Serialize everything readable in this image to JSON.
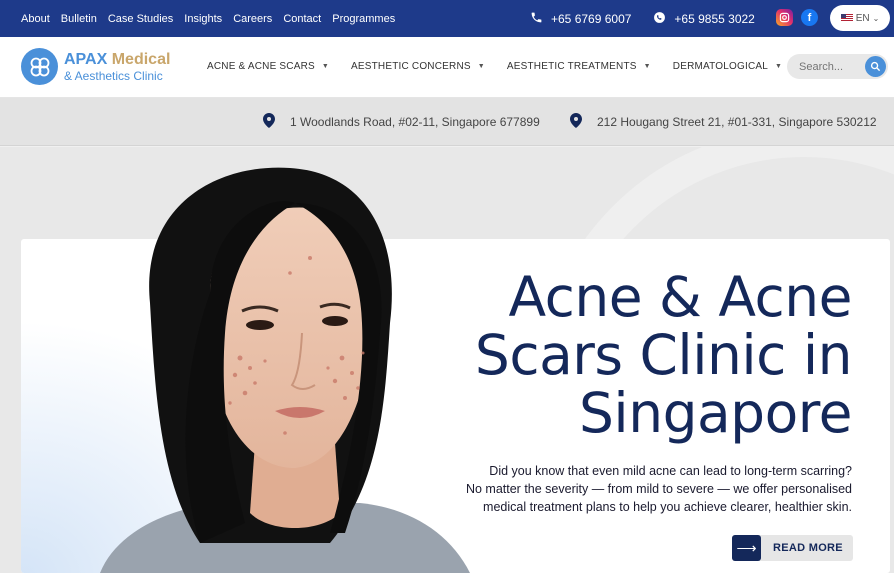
{
  "topbar": {
    "nav": [
      "About",
      "Bulletin",
      "Case Studies",
      "Insights",
      "Careers",
      "Contact",
      "Programmes"
    ],
    "phone": "+65 6769 6007",
    "whatsapp": "+65 9855 3022",
    "lang": "EN"
  },
  "header": {
    "logo_primary": "APAX",
    "logo_secondary": "Medical",
    "logo_sub": "& Aesthetics Clinic",
    "menu": [
      "ACNE & ACNE SCARS",
      "AESTHETIC CONCERNS",
      "AESTHETIC TREATMENTS",
      "DERMATOLOGICAL"
    ],
    "search_placeholder": "Search..."
  },
  "addresses": [
    "1 Woodlands Road, #02-11, Singapore 677899",
    "212 Hougang Street 21, #01-331, Singapore 530212"
  ],
  "hero": {
    "title_line1": "Acne & Acne",
    "title_line2": "Scars Clinic in",
    "title_line3": "Singapore",
    "desc_line1": "Did you know that even mild acne can lead to long-term scarring?",
    "desc_line2": "No matter the severity — from mild to severe — we offer personalised",
    "desc_line3": "medical treatment plans to help you achieve clearer, healthier skin.",
    "cta": "READ MORE"
  },
  "colors": {
    "topbar": "#1e3a8a",
    "brand_blue": "#4a90d9",
    "brand_gold": "#c9a66b",
    "title_navy": "#14285a"
  }
}
